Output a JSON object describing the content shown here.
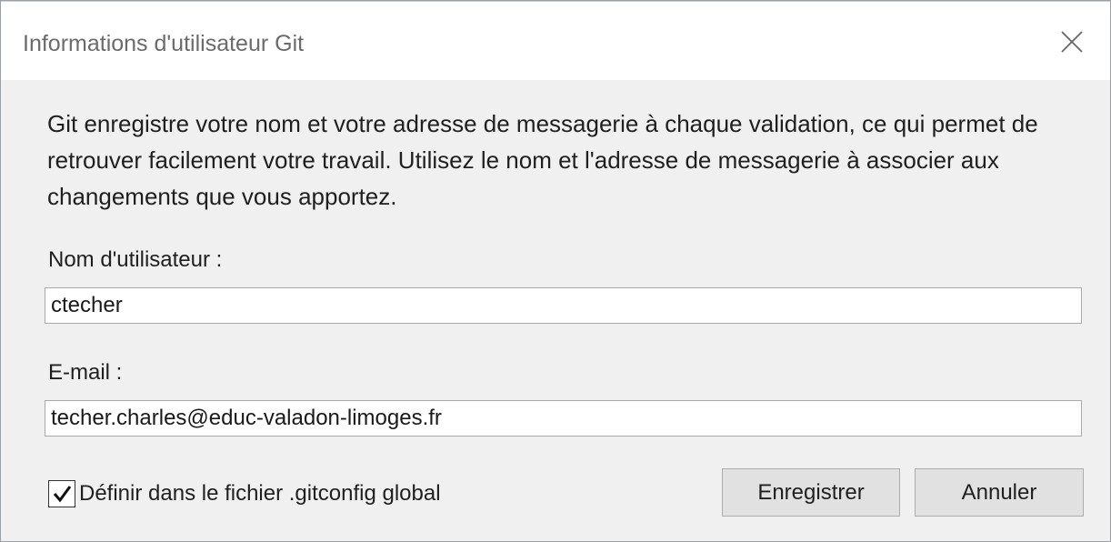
{
  "dialog": {
    "title": "Informations d'utilisateur Git",
    "description": "Git enregistre votre nom et votre adresse de messagerie à chaque validation, ce qui permet de retrouver facilement votre travail. Utilisez le nom et l'adresse de messagerie à associer aux changements que vous apportez.",
    "username": {
      "label": "Nom d'utilisateur :",
      "value": "ctecher"
    },
    "email": {
      "label": "E-mail :",
      "value": "techer.charles@educ-valadon-limoges.fr"
    },
    "global_config": {
      "label": "Définir dans le fichier .gitconfig global",
      "checked": true
    },
    "buttons": {
      "save": "Enregistrer",
      "cancel": "Annuler"
    }
  },
  "icons": {
    "close": "close-icon",
    "check": "checkmark-icon"
  },
  "colors": {
    "accent": "#4a5a9c",
    "dialog_bg": "#f0f0f0",
    "title_text": "#6b6b6b",
    "button_bg": "#e1e1e1"
  }
}
